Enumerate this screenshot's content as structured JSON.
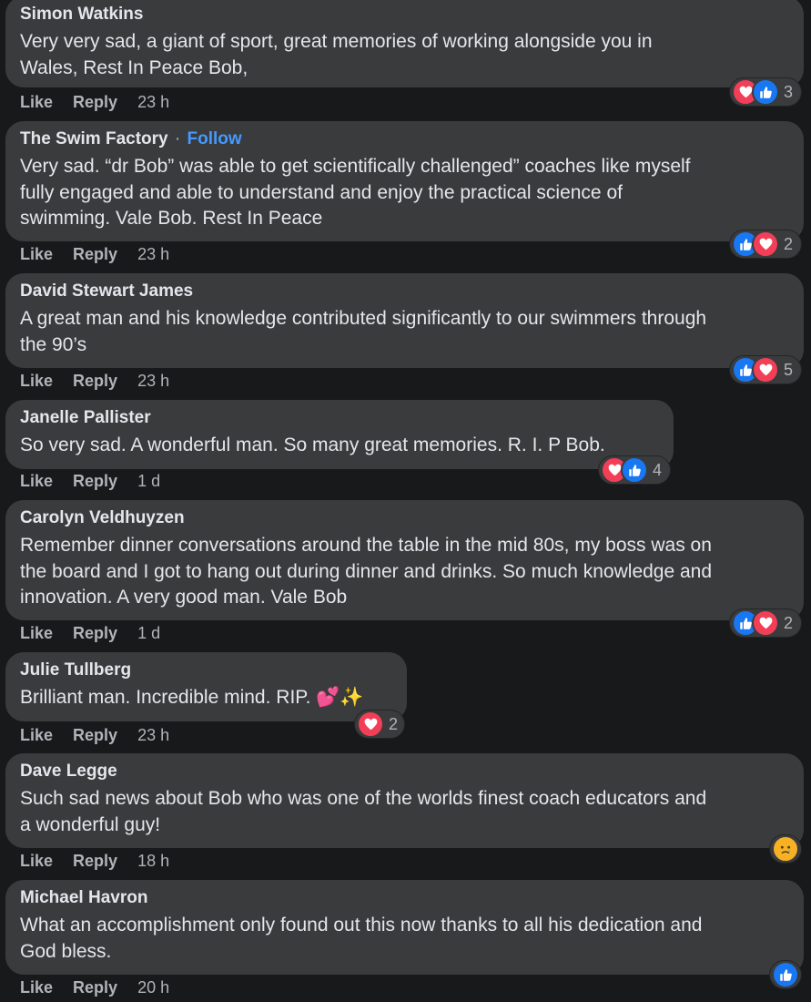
{
  "actions": {
    "like": "Like",
    "reply": "Reply"
  },
  "comments": [
    {
      "author": "Simon Watkins",
      "lines": [
        "Very very sad, a giant of sport, great memories of working alongside you in",
        "Wales, Rest In Peace Bob,"
      ],
      "time": "23 h",
      "reactions": {
        "icons": [
          "heart",
          "like"
        ],
        "count": "3"
      }
    },
    {
      "author": "The Swim Factory",
      "separator": "·",
      "follow": "Follow",
      "lines": [
        "Very sad. “dr Bob” was able to get scientifically challenged” coaches like myself",
        "fully engaged and able to understand and enjoy the practical science of",
        "swimming. Vale Bob. Rest In Peace"
      ],
      "time": "23 h",
      "reactions": {
        "icons": [
          "like",
          "heart"
        ],
        "count": "2"
      }
    },
    {
      "author": "David Stewart James",
      "lines": [
        "A great man and his knowledge contributed significantly to our swimmers through",
        "the 90’s"
      ],
      "time": "23 h",
      "reactions": {
        "icons": [
          "like",
          "heart"
        ],
        "count": "5"
      }
    },
    {
      "author": "Janelle Pallister",
      "lines": [
        "So very sad. A wonderful man. So many great memories. R. I. P Bob."
      ],
      "time": "1 d",
      "reactions": {
        "icons": [
          "heart",
          "like"
        ],
        "count": "4"
      }
    },
    {
      "author": "Carolyn Veldhuyzen",
      "lines": [
        "Remember dinner conversations around the table in the mid 80s, my boss was on",
        "the board and I got to hang out during dinner and drinks. So much knowledge and",
        "innovation. A very good man. Vale Bob"
      ],
      "time": "1 d",
      "reactions": {
        "icons": [
          "like",
          "heart"
        ],
        "count": "2"
      }
    },
    {
      "author": "Julie Tullberg",
      "lines": [
        "Brilliant man. Incredible mind. RIP. 💕✨"
      ],
      "time": "23 h",
      "reactions": {
        "icons": [
          "heart"
        ],
        "count": "2"
      }
    },
    {
      "author": "Dave Legge",
      "lines": [
        "Such sad news about Bob who was one of the worlds finest coach educators and",
        "a wonderful guy!"
      ],
      "time": "18 h",
      "reactions": {
        "icons": [
          "sad"
        ],
        "count": ""
      }
    },
    {
      "author": "Michael Havron",
      "lines": [
        "What an accomplishment only found out this now thanks to all his dedication and",
        "God bless."
      ],
      "time": "20 h",
      "reactions": {
        "icons": [
          "like"
        ],
        "count": ""
      }
    }
  ],
  "colors": {
    "background": "#18191a",
    "bubble": "#3a3b3c",
    "link": "#4599ff",
    "heart": "#f33e58",
    "like": "#1877f2"
  }
}
